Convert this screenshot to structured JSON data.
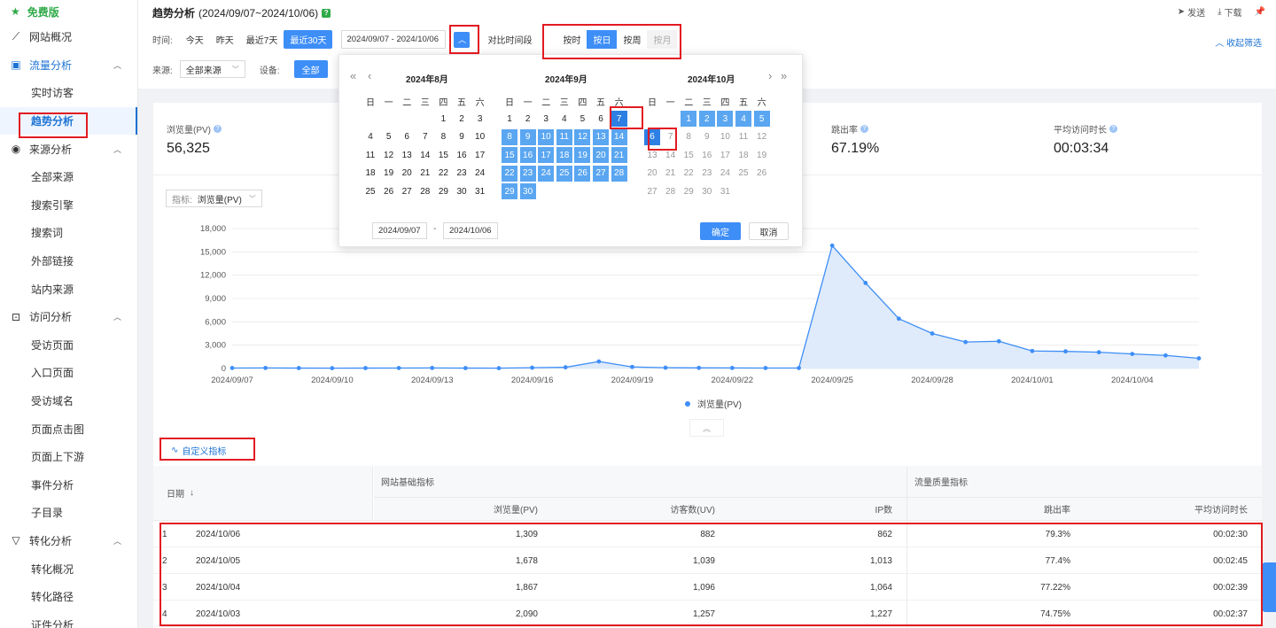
{
  "sidebar": {
    "brand": "免费版",
    "items": [
      {
        "type": "group",
        "icon": "line-chart-icon",
        "label": "网站概况"
      },
      {
        "type": "group",
        "icon": "image-icon",
        "label": "流量分析",
        "active": true,
        "chevron": "up"
      },
      {
        "type": "sub",
        "label": "实时访客"
      },
      {
        "type": "sub",
        "label": "趋势分析",
        "selected": true
      },
      {
        "type": "group",
        "icon": "signal-icon",
        "label": "来源分析",
        "chevron": "up"
      },
      {
        "type": "sub",
        "label": "全部来源"
      },
      {
        "type": "sub",
        "label": "搜索引擎"
      },
      {
        "type": "sub",
        "label": "搜索词"
      },
      {
        "type": "sub",
        "label": "外部链接"
      },
      {
        "type": "sub",
        "label": "站内来源"
      },
      {
        "type": "group",
        "icon": "download-box-icon",
        "label": "访问分析",
        "chevron": "up"
      },
      {
        "type": "sub",
        "label": "受访页面"
      },
      {
        "type": "sub",
        "label": "入口页面"
      },
      {
        "type": "sub",
        "label": "受访域名"
      },
      {
        "type": "sub",
        "label": "页面点击图"
      },
      {
        "type": "sub",
        "label": "页面上下游"
      },
      {
        "type": "sub",
        "label": "事件分析"
      },
      {
        "type": "sub",
        "label": "子目录"
      },
      {
        "type": "group",
        "icon": "funnel-icon",
        "label": "转化分析",
        "chevron": "up"
      },
      {
        "type": "sub",
        "label": "转化概况"
      },
      {
        "type": "sub",
        "label": "转化路径"
      },
      {
        "type": "sub",
        "label": "证件分析"
      }
    ]
  },
  "header": {
    "title": "趋势分析",
    "range": "(2024/09/07~2024/10/06)",
    "actions": {
      "send": "发送",
      "download": "下载"
    }
  },
  "filters": {
    "time_label": "时间:",
    "quick": [
      {
        "label": "今天",
        "on": false
      },
      {
        "label": "昨天",
        "on": false
      },
      {
        "label": "最近7天",
        "on": false
      },
      {
        "label": "最近30天",
        "on": true
      }
    ],
    "date_range": "2024/09/07 - 2024/10/06",
    "compare": "对比时间段",
    "granularity": [
      {
        "label": "按时",
        "state": "normal"
      },
      {
        "label": "按日",
        "state": "on"
      },
      {
        "label": "按周",
        "state": "normal"
      },
      {
        "label": "按月",
        "state": "disabled"
      }
    ],
    "collapse": "收起筛选",
    "source_label": "来源:",
    "source_value": "全部来源",
    "device_label": "设备:",
    "device_value": "全部"
  },
  "calendar": {
    "weekdays": [
      "日",
      "一",
      "二",
      "三",
      "四",
      "五",
      "六"
    ],
    "months": [
      {
        "title": "2024年8月",
        "lead": 4,
        "days": 31,
        "range_from": null,
        "range_to": null,
        "trail": 0
      },
      {
        "title": "2024年9月",
        "lead": 0,
        "days": 30,
        "range_from": 7,
        "range_to": 30,
        "trail": 0
      },
      {
        "title": "2024年10月",
        "lead": 2,
        "days": 31,
        "range_from": 1,
        "range_to": 6,
        "trail": 0
      }
    ],
    "start": "2024/09/07",
    "end": "2024/10/06",
    "confirm": "确定",
    "cancel": "取消"
  },
  "stats": [
    {
      "label": "浏览量(PV)",
      "value": "56,325"
    },
    {
      "label": "跳出率",
      "value": "67.19%"
    },
    {
      "label": "平均访问时长",
      "value": "00:03:34"
    }
  ],
  "metric": {
    "label": "指标:",
    "value": "浏览量(PV)"
  },
  "chart_data": {
    "type": "area",
    "x": [
      "2024/09/07",
      "2024/09/08",
      "2024/09/09",
      "2024/09/10",
      "2024/09/11",
      "2024/09/12",
      "2024/09/13",
      "2024/09/14",
      "2024/09/15",
      "2024/09/16",
      "2024/09/17",
      "2024/09/18",
      "2024/09/19",
      "2024/09/20",
      "2024/09/21",
      "2024/09/22",
      "2024/09/23",
      "2024/09/24",
      "2024/09/25",
      "2024/09/26",
      "2024/09/27",
      "2024/09/28",
      "2024/09/29",
      "2024/09/30",
      "2024/10/01",
      "2024/10/02",
      "2024/10/03",
      "2024/10/04",
      "2024/10/05",
      "2024/10/06"
    ],
    "tick_labels": [
      "2024/09/07",
      "2024/09/10",
      "2024/09/13",
      "2024/09/16",
      "2024/09/19",
      "2024/09/22",
      "2024/09/25",
      "2024/09/28",
      "2024/10/01",
      "2024/10/04"
    ],
    "series": [
      {
        "name": "浏览量(PV)",
        "values": [
          60,
          70,
          50,
          40,
          50,
          60,
          70,
          50,
          40,
          100,
          150,
          900,
          200,
          100,
          80,
          70,
          60,
          60,
          15800,
          11000,
          6400,
          4500,
          3400,
          3500,
          2250,
          2200,
          2090,
          1867,
          1678,
          1309
        ]
      }
    ],
    "ylim": [
      0,
      18000
    ],
    "yticks": [
      "0",
      "3,000",
      "6,000",
      "9,000",
      "12,000",
      "15,000",
      "18,000"
    ],
    "grid": true,
    "legend": "bottom",
    "color": "#3e8ef7"
  },
  "custom_metric": "自定义指标",
  "table": {
    "date_header": "日期",
    "group1": "网站基础指标",
    "group2": "流量质量指标",
    "columns": [
      "浏览量(PV)",
      "访客数(UV)",
      "IP数",
      "跳出率",
      "平均访问时长"
    ],
    "rows": [
      {
        "idx": "1",
        "date": "2024/10/06",
        "pv": "1,309",
        "uv": "882",
        "ip": "862",
        "bounce": "79.3%",
        "dur": "00:02:30"
      },
      {
        "idx": "2",
        "date": "2024/10/05",
        "pv": "1,678",
        "uv": "1,039",
        "ip": "1,013",
        "bounce": "77.4%",
        "dur": "00:02:45"
      },
      {
        "idx": "3",
        "date": "2024/10/04",
        "pv": "1,867",
        "uv": "1,096",
        "ip": "1,064",
        "bounce": "77.22%",
        "dur": "00:02:39"
      },
      {
        "idx": "4",
        "date": "2024/10/03",
        "pv": "2,090",
        "uv": "1,257",
        "ip": "1,227",
        "bounce": "74.75%",
        "dur": "00:02:37"
      }
    ]
  }
}
